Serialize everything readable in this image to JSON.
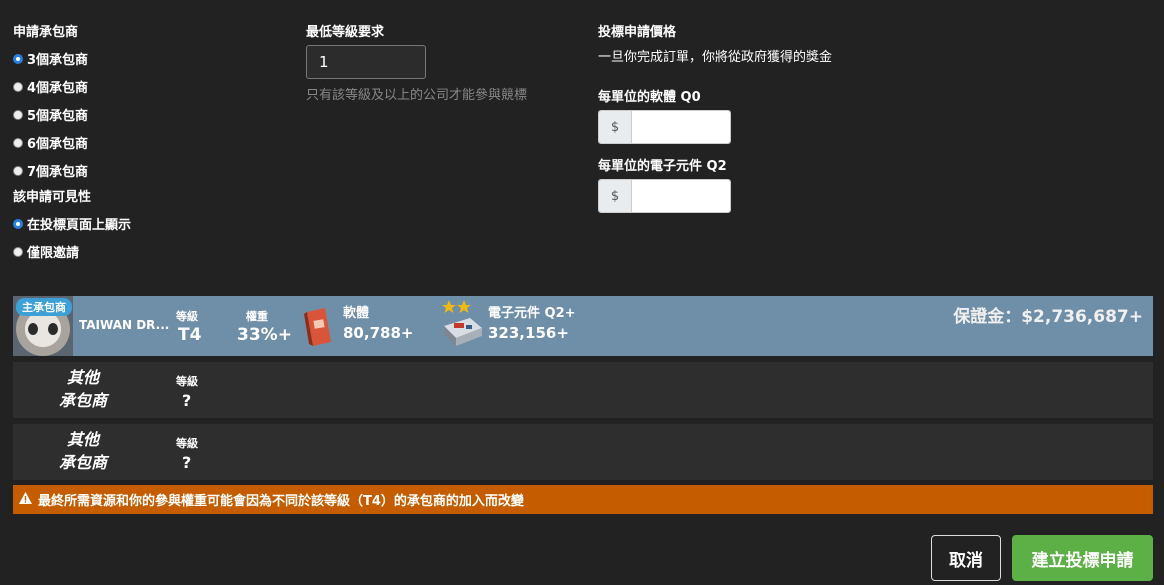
{
  "contractors": {
    "heading": "申請承包商",
    "options": [
      "3個承包商",
      "4個承包商",
      "5個承包商",
      "6個承包商",
      "7個承包商"
    ],
    "selected_index": 0
  },
  "visibility": {
    "heading": "該申請可見性",
    "options": [
      "在投標頁面上顯示",
      "僅限邀請"
    ],
    "selected_index": 0
  },
  "min_level": {
    "heading": "最低等級要求",
    "value": "1",
    "hint": "只有該等級及以上的公司才能參與競標"
  },
  "bid_price": {
    "heading": "投標申請價格",
    "description": "一旦你完成訂單，你將從政府獲得的獎金",
    "software_label": "每單位的軟體 Q0",
    "electronics_label": "每單位的電子元件 Q2",
    "currency_symbol": "$"
  },
  "main_contractor": {
    "badge": "主承包商",
    "name": "TAIWAN DR...",
    "level_label": "等級",
    "level_value": "T4",
    "weight_label": "權重",
    "weight_value": "33%+",
    "resource1_label": "軟體",
    "resource1_value": "80,788+",
    "resource2_label": "電子元件 Q2+",
    "resource2_value": "323,156+",
    "resource2_stars": 2,
    "deposit": "保證金：$2,736,687+"
  },
  "other_contractors": [
    {
      "title_line1": "其他",
      "title_line2": "承包商",
      "level_label": "等級",
      "level_value": "?"
    },
    {
      "title_line1": "其他",
      "title_line2": "承包商",
      "level_label": "等級",
      "level_value": "?"
    }
  ],
  "warning": "最終所需資源和你的參與權重可能會因為不同於該等級（T4）的承包商的加入而改變",
  "buttons": {
    "cancel": "取消",
    "create": "建立投標申請"
  },
  "colors": {
    "background": "#222222",
    "main_row": "#6f8ea8",
    "warning": "#c55d00",
    "create_button": "#5cb045",
    "radio_checked": "#2a7de1"
  }
}
